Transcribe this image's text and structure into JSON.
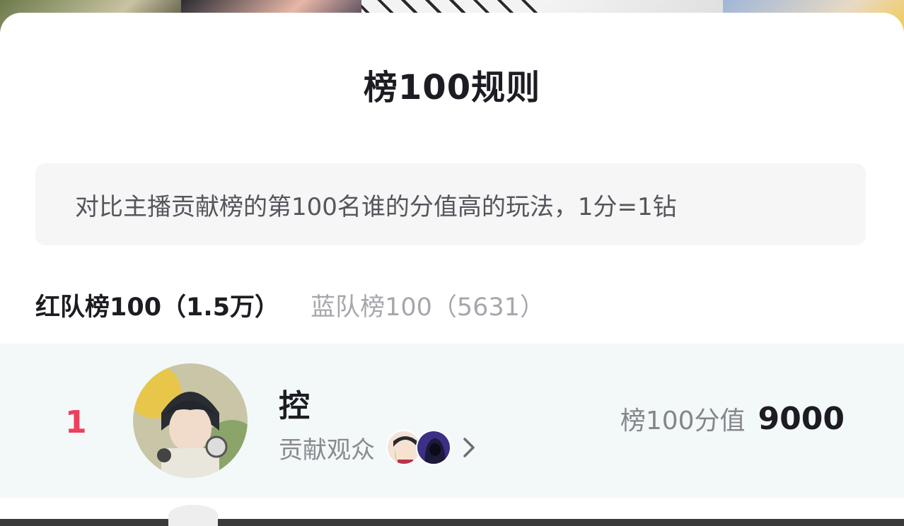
{
  "sheet": {
    "title": "榜100规则",
    "description": "对比主播贡献榜的第100名谁的分值高的玩法，1分=1钻"
  },
  "tabs": [
    {
      "label": "红队榜100（1.5万）",
      "active": true
    },
    {
      "label": "蓝队榜100（5631）",
      "active": false
    }
  ],
  "entries": [
    {
      "rank": "1",
      "name": "控",
      "audience_label": "贡献观众",
      "score_label": "榜100分值",
      "score_value": "9000"
    }
  ],
  "colors": {
    "rank_accent": "#ef3e5c",
    "row_background": "#f3f8f9"
  },
  "icons": [
    "chevron-right-icon"
  ]
}
